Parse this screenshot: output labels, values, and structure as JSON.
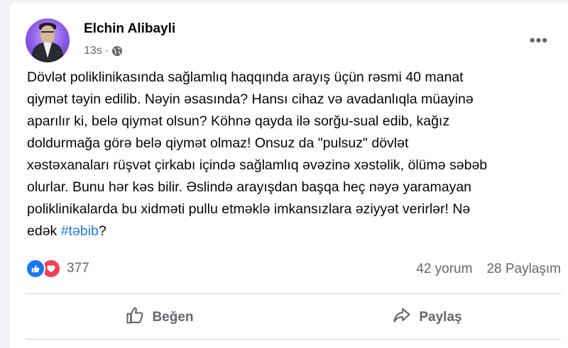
{
  "post": {
    "author": "Elchin Alibayli",
    "time": "13s",
    "separator": "·",
    "text_before_hashtag": "Dövlət poliklinikasında sağlamlıq haqqında arayış üçün rəsmi 40 manat\nqiymət təyin edilib. Nəyin əsasında? Hansı cihaz və avadanlıqla müayinə\naparılır ki, belə qiymət olsun? Köhnə qayda ilə sorğu-sual edib, kağız\ndoldurmağa görə belə qiymət olmaz! Onsuz da \"pulsuz\" dövlət\nxəstəxanaları rüşvət çirkabı içində sağlamlıq əvəzinə xəstəlik, ölümə səbəb\nolurlar. Bunu hər kəs bilir. Əslində arayışdan başqa heç nəyə yaramayan\npoliklinikalarda bu xidməti pullu etməklə imkansızlara əziyyət verirlər! Nə\nedək ",
    "hashtag": "#təbib",
    "text_after_hashtag": "?"
  },
  "reactions": {
    "count": "377",
    "types": [
      "like",
      "love"
    ]
  },
  "stats": {
    "comments": "42 yorum",
    "shares": "28 Paylaşım"
  },
  "actions": {
    "like_label": "Beğen",
    "share_label": "Paylaş"
  },
  "icons": {
    "menu": "more-horizontal-icon",
    "privacy": "globe-icon",
    "like": "thumbs-up-icon",
    "share": "share-arrow-icon"
  },
  "colors": {
    "link": "#1877f2",
    "like_reaction": "#1877f2",
    "love_reaction": "#f33e58",
    "secondary_text": "#65676b"
  }
}
